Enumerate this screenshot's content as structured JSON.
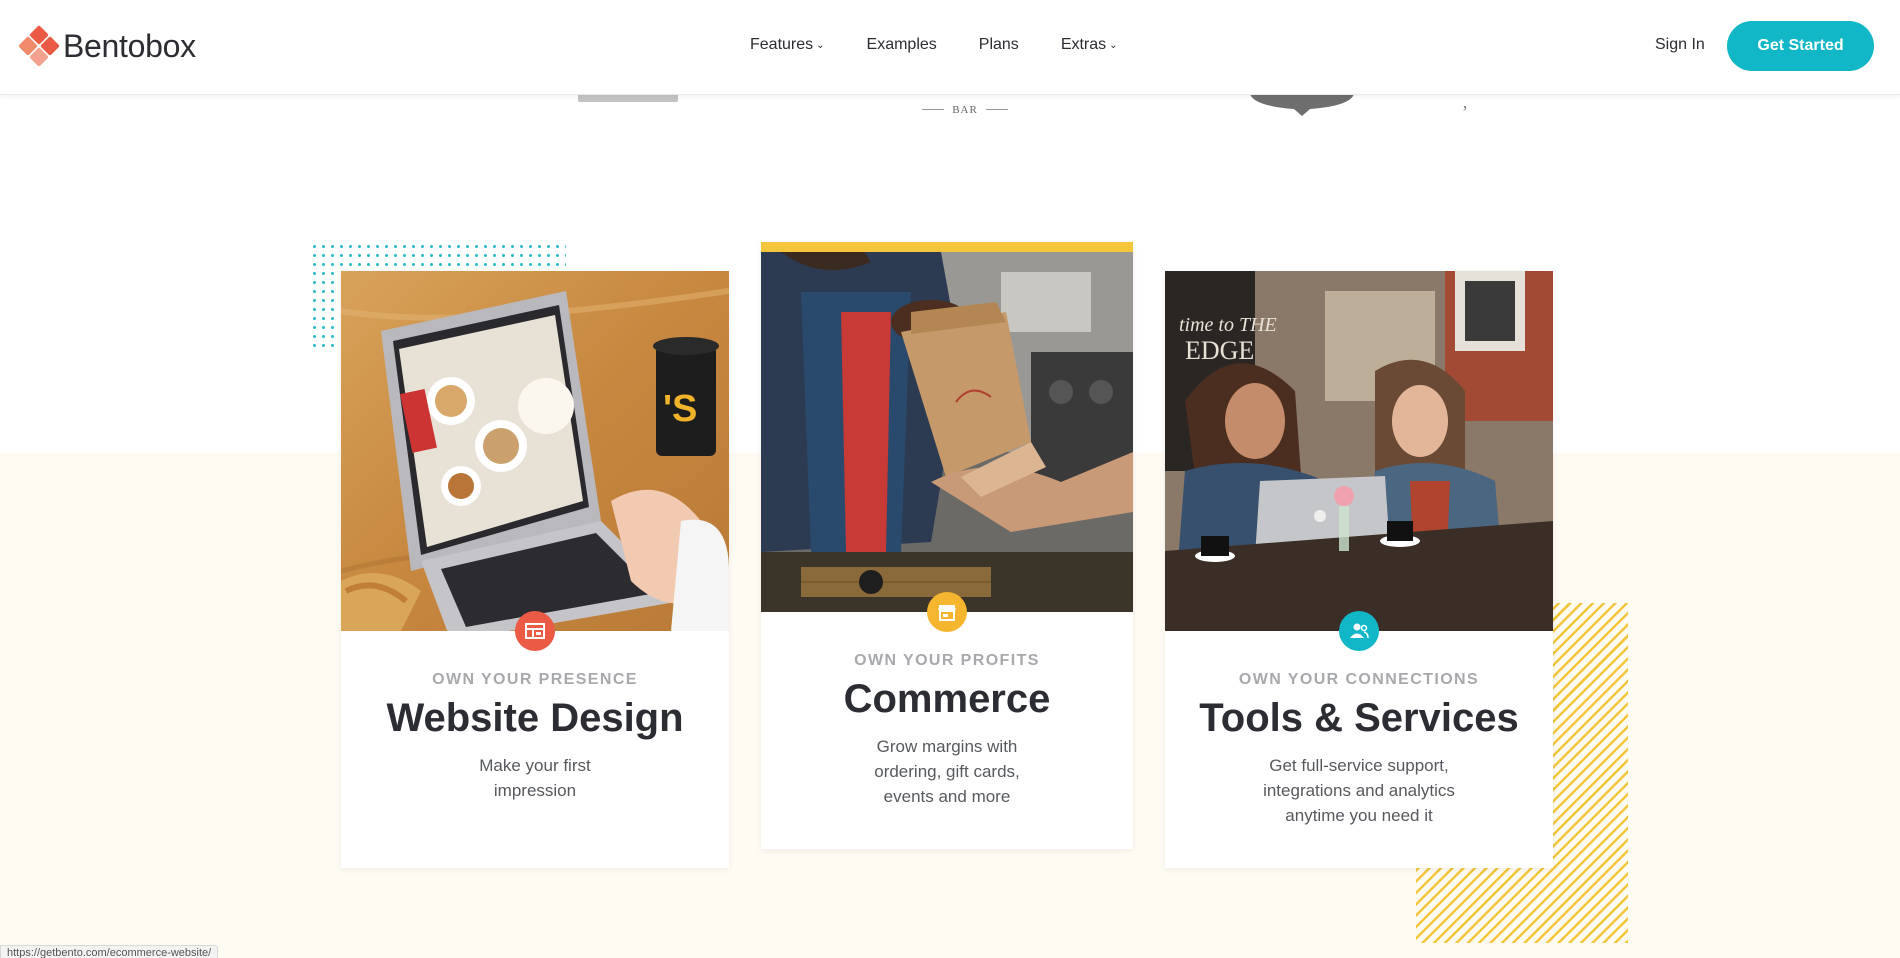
{
  "brand": {
    "name": "Bentobox",
    "accent": "#11b7c7"
  },
  "nav": {
    "items": [
      {
        "label": "Features",
        "dropdown": true
      },
      {
        "label": "Examples",
        "dropdown": false
      },
      {
        "label": "Plans",
        "dropdown": false
      },
      {
        "label": "Extras",
        "dropdown": true
      }
    ],
    "sign_in": "Sign In",
    "cta": "Get Started"
  },
  "partners": {
    "bar_label": "BAR"
  },
  "cards": [
    {
      "eyebrow": "OWN YOUR PRESENCE",
      "title": "Website Design",
      "desc": "Make your first impression",
      "badge_color": "#ea5a45",
      "icon": "layout-icon"
    },
    {
      "eyebrow": "OWN YOUR PROFITS",
      "title": "Commerce",
      "desc": "Grow margins with ordering, gift cards, events and more",
      "badge_color": "#f5b52e",
      "icon": "storefront-icon"
    },
    {
      "eyebrow": "OWN YOUR CONNECTIONS",
      "title": "Tools & Services",
      "desc": "Get full-service support, integrations and analytics anytime you need it",
      "badge_color": "#11b7c7",
      "icon": "user-group-icon"
    }
  ],
  "status_bar": {
    "url": "https://getbento.com/ecommerce-website/"
  }
}
